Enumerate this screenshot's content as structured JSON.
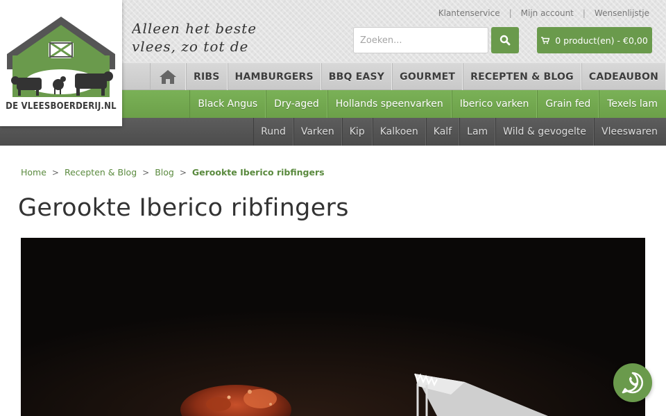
{
  "brand": {
    "name": "DE VLEESBOERDERIJ.NL",
    "tagline_line1": "Alleen het beste",
    "tagline_line2": "vlees, zo tot de"
  },
  "top_links": [
    "Klantenservice",
    "Mijn account",
    "Wensenlijstje"
  ],
  "search": {
    "placeholder": "Zoeken..."
  },
  "cart": {
    "label": "0 product(en) - €0,00"
  },
  "main_nav": [
    "RIBS",
    "HAMBURGERS",
    "BBQ EASY",
    "GOURMET",
    "RECEPTEN & BLOG",
    "CADEAUBON"
  ],
  "green_nav": [
    "Black Angus",
    "Dry-aged",
    "Hollands speenvarken",
    "Iberico varken",
    "Grain fed",
    "Texels lam"
  ],
  "dark_nav": [
    "Rund",
    "Varken",
    "Kip",
    "Kalkoen",
    "Kalf",
    "Lam",
    "Wild & gevogelte",
    "Vleeswaren"
  ],
  "breadcrumb": [
    "Home",
    "Recepten & Blog",
    "Blog",
    "Gerookte Iberico ribfingers"
  ],
  "page": {
    "title": "Gerookte Iberico ribfingers"
  },
  "colors": {
    "accent_green": "#6a9a4c",
    "dark_bar": "#555555",
    "grey_bar": "#d0d0d0"
  },
  "icons": {
    "home": "home-icon",
    "search": "search-icon",
    "cart": "cart-icon",
    "whatsapp": "whatsapp-icon"
  }
}
